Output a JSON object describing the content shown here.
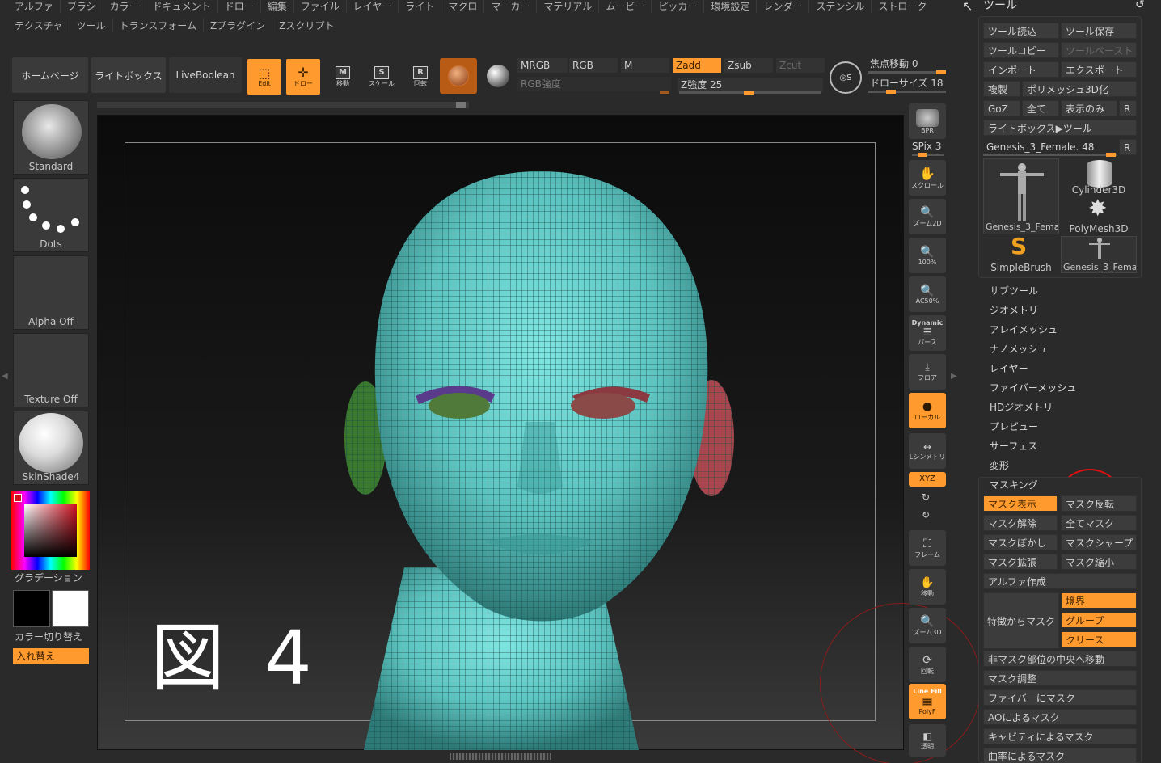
{
  "menu": {
    "row1": [
      "アルファ",
      "ブラシ",
      "カラー",
      "ドキュメント",
      "ドロー",
      "編集",
      "ファイル",
      "レイヤー",
      "ライト",
      "マクロ",
      "マーカー",
      "マテリアル",
      "ムービー",
      "ピッカー",
      "環境設定",
      "レンダー",
      "ステンシル",
      "ストローク"
    ],
    "row2": [
      "テクスチャ",
      "ツール",
      "トランスフォーム",
      "Zプラグイン",
      "Zスクリプト"
    ]
  },
  "toolbar": {
    "home": "ホームページ",
    "lightbox": "ライトボックス",
    "liveboolean": "LiveBoolean",
    "edit": "Edit",
    "draw": "ドロー",
    "move": "移動",
    "scale": "スケール",
    "rotate": "回転",
    "mrgb": "MRGB",
    "rgb": "RGB",
    "m": "M",
    "zadd": "Zadd",
    "zsub": "Zsub",
    "zcut": "Zcut",
    "rgb_intensity": "RGB強度",
    "z_intensity": "Z強度 25",
    "focal_shift": "焦点移動 0",
    "draw_size": "ドローサイズ 18"
  },
  "left": {
    "brush": "Standard",
    "stroke": "Dots",
    "alpha": "Alpha Off",
    "texture": "Texture Off",
    "material": "SkinShade4",
    "gradient": "グラデーション",
    "switch_color": "カラー切り替え",
    "swap": "入れ替え"
  },
  "canvas": {
    "overlay_text": "図 4"
  },
  "rtools": {
    "bpr": "BPR",
    "spix": "SPix 3",
    "scroll": "スクロール",
    "zoom2d": "ズーム2D",
    "zoom100": "100%",
    "ac50": "AC50%",
    "dynamic": "Dynamic",
    "persp": "パース",
    "floor": "フロア",
    "local": "ローカル",
    "symmetry": "Lシンメトリ",
    "xyz": "XYZ",
    "frame": "フレーム",
    "move": "移動",
    "zoom3d": "ズーム3D",
    "rotate": "回転",
    "linefill": "Line Fill",
    "polyf": "PolyF",
    "transp": "透明"
  },
  "tool_panel": {
    "title": "ツール",
    "load": "ツール読込",
    "save": "ツール保存",
    "copy": "ツールコピー",
    "paste": "ツールペースト",
    "import": "インポート",
    "export": "エクスポート",
    "clone": "複製",
    "make3d": "ポリメッシュ3D化",
    "goz": "GoZ",
    "all": "全て",
    "visible": "表示のみ",
    "r": "R",
    "lightbox_tools": "ライトボックス▶ツール",
    "current_tool": "Genesis_3_Female. 48",
    "thumbs": [
      "Genesis_3_Fema",
      "Cylinder3D",
      "PolyMesh3D",
      "SimpleBrush",
      "Genesis_3_Fema"
    ],
    "sections": [
      "サブツール",
      "ジオメトリ",
      "アレイメッシュ",
      "ナノメッシュ",
      "レイヤー",
      "ファイバーメッシュ",
      "HDジオメトリ",
      "プレビュー",
      "サーフェス",
      "変形"
    ],
    "masking": "マスキング",
    "mask_buttons": {
      "view": "マスク表示",
      "invert": "マスク反転",
      "clear": "マスク解除",
      "all": "全てマスク",
      "blur": "マスクぼかし",
      "sharpen": "マスクシャープ",
      "grow": "マスク拡張",
      "shrink": "マスク縮小",
      "alpha": "アルファ作成",
      "by_feature": "特徴からマスク",
      "border": "境界",
      "groups": "グループ",
      "crease": "クリース",
      "center_unmasked": "非マスク部位の中央へ移動",
      "adjust": "マスク調整",
      "by_fiber": "ファイバーにマスク",
      "by_ao": "AOによるマスク",
      "by_cavity": "キャビティによるマスク",
      "by_curvature": "曲率によるマスク"
    }
  }
}
